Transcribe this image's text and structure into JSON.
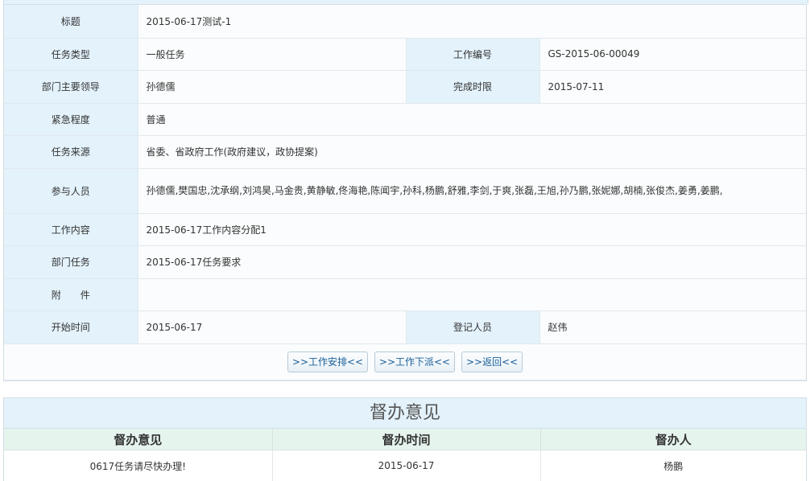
{
  "detail": {
    "title_label": "标题",
    "title_value": "2015-06-17测试-1",
    "type_label": "任务类型",
    "type_value": "一般任务",
    "work_no_label": "工作编号",
    "work_no_value": "GS-2015-06-00049",
    "dept_leader_label": "部门主要领导",
    "dept_leader_value": "孙德儒",
    "deadline_label": "完成时限",
    "deadline_value": "2015-07-11",
    "urgency_label": "紧急程度",
    "urgency_value": "普通",
    "source_label": "任务来源",
    "source_value": "省委、省政府工作(政府建议，政协提案)",
    "participants_label": "参与人员",
    "participants_value": "孙德儒,樊国忠,沈承纲,刘鸿昊,马金贵,黄静敏,佟海艳,陈闻宇,孙科,杨鹏,舒雅,李剑,于爽,张磊,王旭,孙乃鹏,张妮娜,胡楠,张俊杰,姜勇,姜鹏,",
    "content_label": "工作内容",
    "content_value": "2015-06-17工作内容分配1",
    "dept_task_label": "部门任务",
    "dept_task_value": "2015-06-17任务要求",
    "attachment_label": "附　　件",
    "attachment_value": "",
    "start_label": "开始时间",
    "start_value": "2015-06-17",
    "registrar_label": "登记人员",
    "registrar_value": "赵伟"
  },
  "buttons": {
    "arrange": ">>工作安排<<",
    "dispatch": ">>工作下派<<",
    "back": ">>返回<<"
  },
  "supervision": {
    "title": "督办意见",
    "headers": [
      "督办意见",
      "督办时间",
      "督办人"
    ],
    "rows": [
      [
        "0617任务请尽快办理!",
        "2015-06-17",
        "杨鹏"
      ]
    ]
  },
  "colors": {
    "label_bg": "#e3f2fb",
    "header_bg": "#e6f4ee",
    "button_text": "#1a5f98"
  }
}
